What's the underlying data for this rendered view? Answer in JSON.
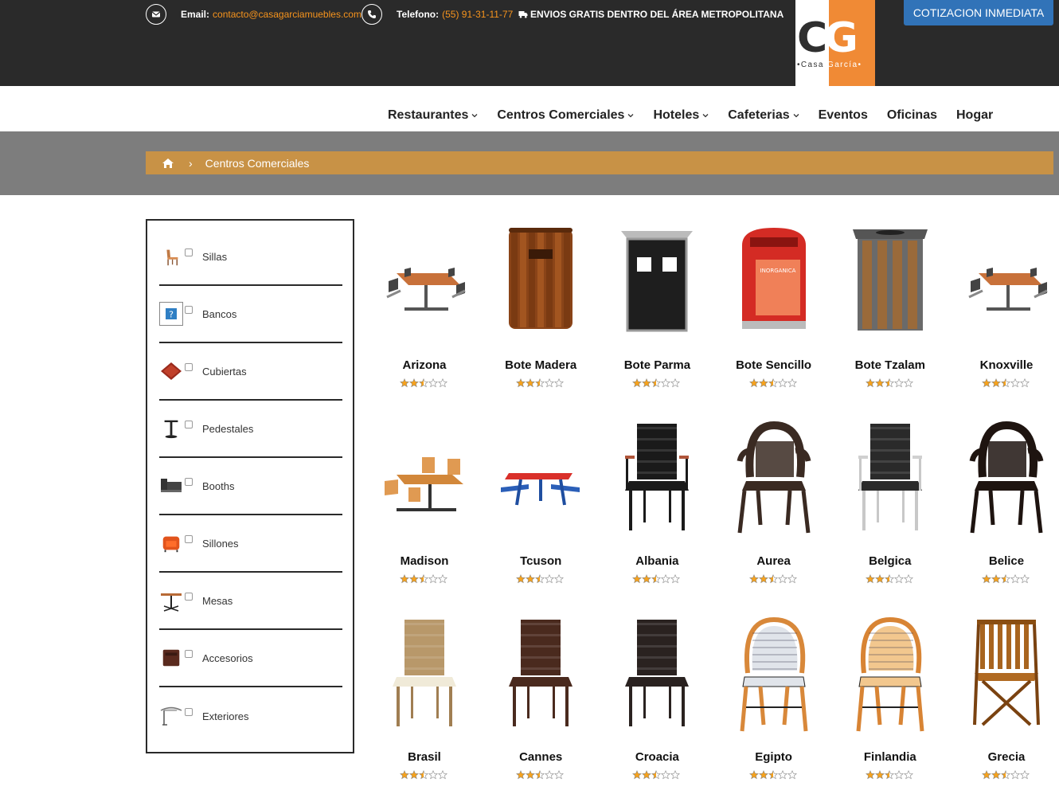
{
  "header": {
    "email_label": "Email:",
    "email": "contacto@casagarciamuebles.com",
    "phone_label": "Telefono:",
    "phone": "(55) 91-31-11-77",
    "shipping": "ENVIOS GRATIS DENTRO DEL ÁREA METROPOLITANA",
    "cta": "COTIZACION INMEDIATA",
    "logo_letters_c": "C",
    "logo_letters_g": "G",
    "logo_name_1": "•Casa",
    "logo_name_2": " García•"
  },
  "nav": [
    {
      "label": "Restaurantes",
      "dropdown": true
    },
    {
      "label": "Centros Comerciales",
      "dropdown": true
    },
    {
      "label": "Hoteles",
      "dropdown": true
    },
    {
      "label": "Cafeterias",
      "dropdown": true
    },
    {
      "label": "Eventos",
      "dropdown": false
    },
    {
      "label": "Oficinas",
      "dropdown": false
    },
    {
      "label": "Hogar",
      "dropdown": false
    }
  ],
  "breadcrumb": {
    "separator": "›",
    "current": "Centros Comerciales"
  },
  "categories": [
    {
      "label": "Sillas",
      "icon": "chair-icon"
    },
    {
      "label": "Bancos",
      "icon": "missing-image-icon"
    },
    {
      "label": "Cubiertas",
      "icon": "tabletop-icon"
    },
    {
      "label": "Pedestales",
      "icon": "pedestal-icon"
    },
    {
      "label": "Booths",
      "icon": "booth-icon"
    },
    {
      "label": "Sillones",
      "icon": "armchair-icon"
    },
    {
      "label": "Mesas",
      "icon": "table-icon"
    },
    {
      "label": "Accesorios",
      "icon": "accessory-icon"
    },
    {
      "label": "Exteriores",
      "icon": "umbrella-icon"
    }
  ],
  "products": [
    {
      "name": "Arizona",
      "kind": "table-set",
      "rating": 2.5
    },
    {
      "name": "Bote Madera",
      "kind": "bin-wood",
      "rating": 2.5
    },
    {
      "name": "Bote Parma",
      "kind": "bin-black",
      "rating": 2.5
    },
    {
      "name": "Bote Sencillo",
      "kind": "bin-red",
      "rating": 2.5,
      "sign": "INORGANICA"
    },
    {
      "name": "Bote Tzalam",
      "kind": "bin-tzalam",
      "rating": 2.5
    },
    {
      "name": "Knoxville",
      "kind": "table-set",
      "rating": 2.5
    },
    {
      "name": "Madison",
      "kind": "table-set-wood",
      "rating": 2.5
    },
    {
      "name": "Tcuson",
      "kind": "picnic",
      "rating": 2.5
    },
    {
      "name": "Albania",
      "kind": "chair-black",
      "rating": 2.5
    },
    {
      "name": "Aurea",
      "kind": "chair-arm-brown",
      "rating": 2.5
    },
    {
      "name": "Belgica",
      "kind": "chair-arm-grey",
      "rating": 2.5
    },
    {
      "name": "Belice",
      "kind": "chair-arm-dark",
      "rating": 2.5
    },
    {
      "name": "Brasil",
      "kind": "chair-wicker",
      "rating": 2.5
    },
    {
      "name": "Cannes",
      "kind": "chair-brown",
      "rating": 2.5
    },
    {
      "name": "Croacia",
      "kind": "chair-dark",
      "rating": 2.5
    },
    {
      "name": "Egipto",
      "kind": "chair-bistro-white",
      "rating": 2.5
    },
    {
      "name": "Finlandia",
      "kind": "chair-bistro-orange",
      "rating": 2.5
    },
    {
      "name": "Grecia",
      "kind": "chair-folding",
      "rating": 2.5
    }
  ],
  "colors": {
    "topbar": "#2a2a2a",
    "accent_orange": "#f7941d",
    "cta_blue": "#3173b8",
    "breadcrumb": "#c89246",
    "band": "#7d7d7d",
    "star": "#f7a21b"
  }
}
